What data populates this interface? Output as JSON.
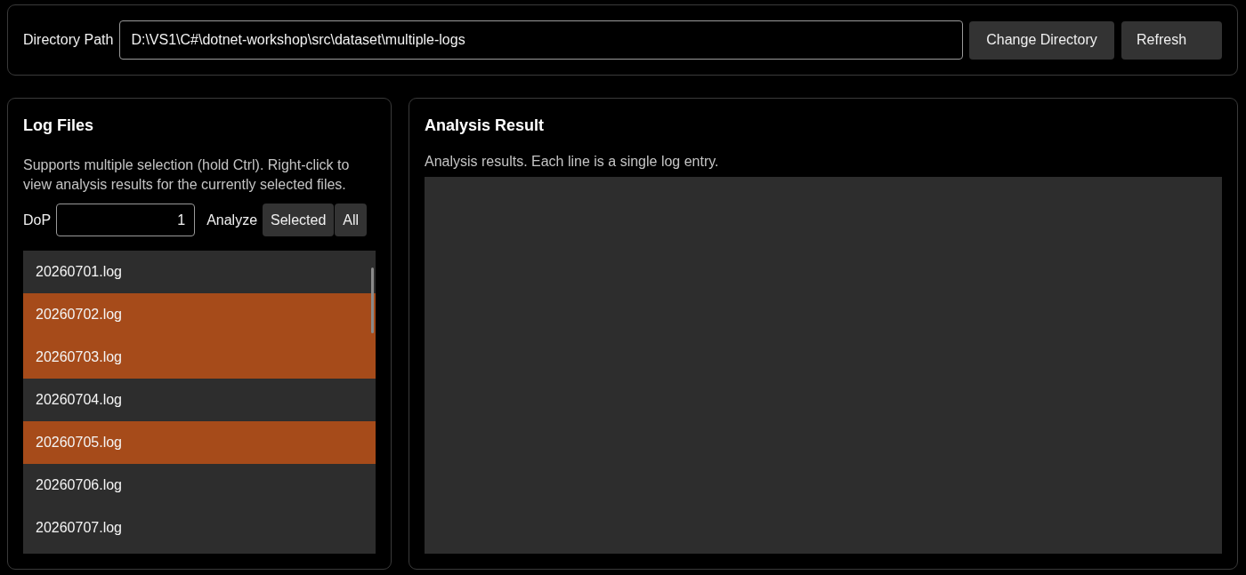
{
  "directory": {
    "label": "Directory Path",
    "value": "D:\\VS1\\C#\\dotnet-workshop\\src\\dataset\\multiple-logs",
    "buttons": [
      "Change Directory",
      "Refresh"
    ]
  },
  "log_files": {
    "title": "Log Files",
    "description": "Supports multiple selection (hold Ctrl). Right-click to view analysis results for the currently selected files.",
    "dop": {
      "label": "DoP",
      "value": "1"
    },
    "analyze": {
      "label": "Analyze",
      "buttons": [
        "Selected",
        "All"
      ]
    },
    "files": [
      {
        "name": "20260701.log",
        "selected": false
      },
      {
        "name": "20260702.log",
        "selected": true
      },
      {
        "name": "20260703.log",
        "selected": true
      },
      {
        "name": "20260704.log",
        "selected": false
      },
      {
        "name": "20260705.log",
        "selected": true
      },
      {
        "name": "20260706.log",
        "selected": false
      },
      {
        "name": "20260707.log",
        "selected": false
      }
    ]
  },
  "analysis": {
    "title": "Analysis Result",
    "description": "Analysis results. Each line is a single log entry."
  }
}
